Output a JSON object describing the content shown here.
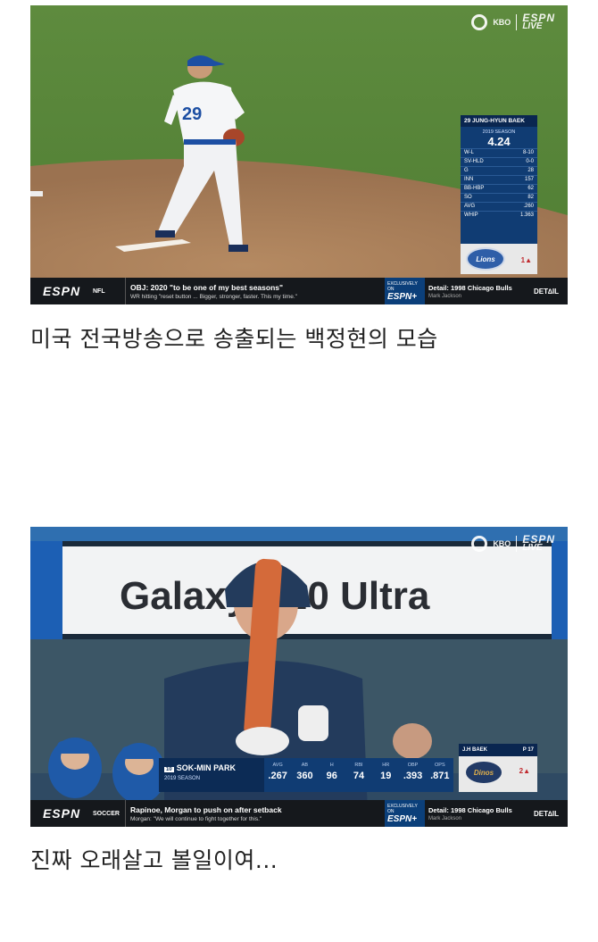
{
  "shot1": {
    "bug": {
      "kbo": "KBO",
      "espn": "ESPN",
      "live": "LIVE"
    },
    "jersey_number": "29",
    "stat_panel": {
      "header": "29  JUNG-HYUN BAEK",
      "season": "2019 SEASON",
      "era": "4.24",
      "rows": [
        {
          "k": "W-L",
          "v": "8-10"
        },
        {
          "k": "SV-HLD",
          "v": "0-0"
        },
        {
          "k": "G",
          "v": "28"
        },
        {
          "k": "INN",
          "v": "157"
        },
        {
          "k": "BB-HBP",
          "v": "62"
        },
        {
          "k": "SO",
          "v": "82"
        },
        {
          "k": "AVG",
          "v": ".260"
        },
        {
          "k": "WHIP",
          "v": "1.363"
        }
      ],
      "team_logo": "Lions",
      "inning": "1▲"
    },
    "ticker": {
      "logo": "ESPN",
      "league": "NFL",
      "headline": "OBJ: 2020 \"to be one of my best seasons\"",
      "sub": "WR hitting \"reset button ... Bigger, stronger, faster. This my time.\"",
      "exclusive": "EXCLUSIVELY ON",
      "espn_plus": "ESPN+",
      "detail_head": "Detail: 1998 Chicago Bulls",
      "detail_sub": "Mark Jackson",
      "detail_mark": "DET∆IL"
    }
  },
  "caption1": "미국 전국방송으로 송출되는 백정현의 모습",
  "shot2": {
    "bug": {
      "kbo": "KBO",
      "espn": "ESPN",
      "live": "LIVE"
    },
    "billboard": "Galaxy S20 Ultra",
    "lower_third": {
      "number": "10",
      "name": "SOK-MIN PARK",
      "season": "2019 SEASON",
      "stats": [
        {
          "k": "AVG",
          "v": ".267"
        },
        {
          "k": "AB",
          "v": "360"
        },
        {
          "k": "H",
          "v": "96"
        },
        {
          "k": "RBI",
          "v": "74"
        },
        {
          "k": "HR",
          "v": "19"
        },
        {
          "k": "OBP",
          "v": ".393"
        },
        {
          "k": "OPS",
          "v": ".871"
        }
      ],
      "batter_label": "J.H BAEK",
      "pitch_label": "P",
      "pitch_count": "17",
      "team_logo": "Dinos",
      "inning": "2▲"
    },
    "ticker": {
      "logo": "ESPN",
      "league": "SOCCER",
      "headline": "Rapinoe, Morgan to push on after setback",
      "sub": "Morgan: \"We will continue to fight together for this.\"",
      "exclusive": "EXCLUSIVELY ON",
      "espn_plus": "ESPN+",
      "detail_head": "Detail: 1998 Chicago Bulls",
      "detail_sub": "Mark Jackson",
      "detail_mark": "DET∆IL"
    }
  },
  "caption2": "진짜 오래살고 볼일이여..."
}
